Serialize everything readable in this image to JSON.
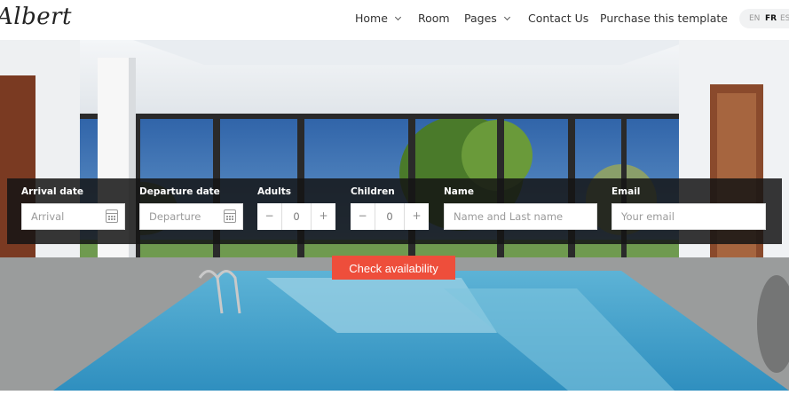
{
  "header": {
    "logo": "Albert",
    "nav": [
      {
        "label": "Home",
        "dropdown": true
      },
      {
        "label": "Room",
        "dropdown": false
      },
      {
        "label": "Pages",
        "dropdown": true
      },
      {
        "label": "Contact Us",
        "dropdown": false
      },
      {
        "label": "Purchase this template",
        "dropdown": false
      }
    ],
    "languages": [
      "EN",
      "FR",
      "ES"
    ],
    "active_language": "FR"
  },
  "booking": {
    "arrival": {
      "label": "Arrival date",
      "placeholder": "Arrival"
    },
    "departure": {
      "label": "Departure date",
      "placeholder": "Departure"
    },
    "adults": {
      "label": "Adults",
      "value": "0",
      "minus": "−",
      "plus": "+"
    },
    "children": {
      "label": "Children",
      "value": "0",
      "minus": "−",
      "plus": "+"
    },
    "name": {
      "label": "Name",
      "placeholder": "Name and Last name"
    },
    "email": {
      "label": "Email",
      "placeholder": "Your email"
    },
    "submit_label": "Check availability"
  },
  "colors": {
    "accent": "#ee4e3b",
    "overlay": "#141414"
  }
}
